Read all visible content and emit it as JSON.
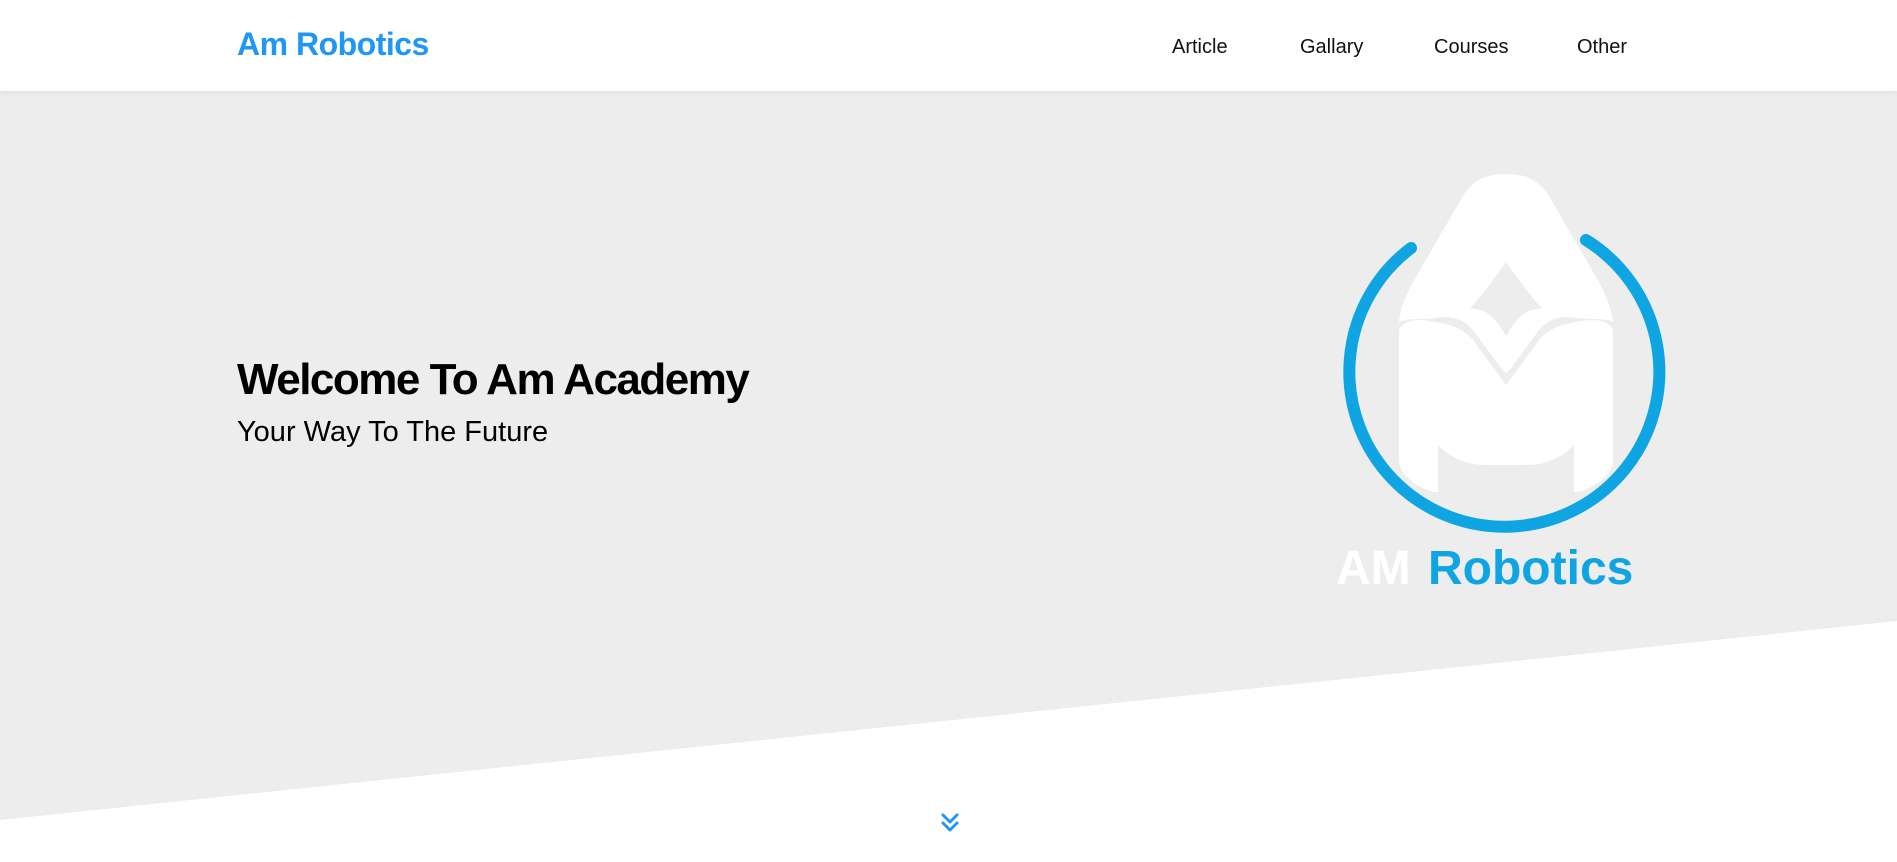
{
  "header": {
    "brand": "Am Robotics",
    "nav": [
      {
        "label": "Article"
      },
      {
        "label": "Gallary"
      },
      {
        "label": "Courses"
      },
      {
        "label": "Other"
      }
    ]
  },
  "hero": {
    "title": "Welcome To Am Academy",
    "subtitle": "Your Way To The Future",
    "logo": {
      "text_part1": "AM",
      "text_part2": "Robotics"
    }
  },
  "colors": {
    "accent": "#2196f3",
    "logo_blue": "#0ea5e2",
    "hero_bg": "#ededed"
  },
  "icons": {
    "scroll": "double-chevron-down-icon"
  }
}
